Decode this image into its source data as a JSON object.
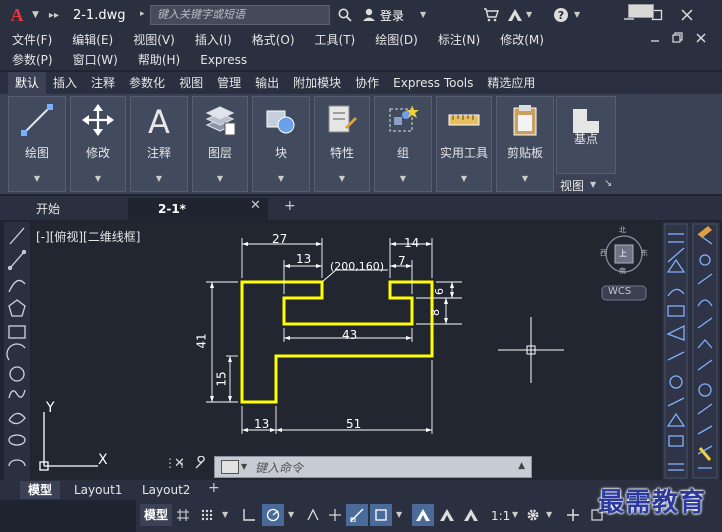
{
  "window": {
    "logo_letter": "A",
    "document_title": "2-1.dwg",
    "search_placeholder": "键入关键字或短语",
    "login_label": "登录"
  },
  "menu": {
    "row1": [
      "文件(F)",
      "编辑(E)",
      "视图(V)",
      "插入(I)",
      "格式(O)",
      "工具(T)",
      "绘图(D)",
      "标注(N)",
      "修改(M)"
    ],
    "row2": [
      "参数(P)",
      "窗口(W)",
      "帮助(H)",
      "Express"
    ]
  },
  "ribbon_tabs": [
    "默认",
    "插入",
    "注释",
    "参数化",
    "视图",
    "管理",
    "输出",
    "附加模块",
    "协作",
    "Express Tools",
    "精选应用"
  ],
  "ribbon_panels": [
    {
      "label": "绘图",
      "icon": "line-tool-icon"
    },
    {
      "label": "修改",
      "icon": "move-icon"
    },
    {
      "label": "注释",
      "icon": "text-a-icon"
    },
    {
      "label": "图层",
      "icon": "layers-icon"
    },
    {
      "label": "块",
      "icon": "block-icon"
    },
    {
      "label": "特性",
      "icon": "properties-icon"
    },
    {
      "label": "组",
      "icon": "group-icon"
    },
    {
      "label": "实用工具",
      "icon": "measure-icon"
    },
    {
      "label": "剪贴板",
      "icon": "clipboard-icon"
    },
    {
      "label": "基点",
      "icon": "base-point-icon"
    }
  ],
  "view_panel_label": "视图",
  "doc_tabs": [
    {
      "label": "开始"
    },
    {
      "label": "2-1*"
    }
  ],
  "drawing": {
    "view_caption": "[-][俯视][二维线框]",
    "dimensions": {
      "d27": "27",
      "d13_top": "13",
      "d200_160": "(200,160)",
      "d14": "14",
      "d7": "7",
      "d6": "6",
      "d8": "8",
      "d43": "43",
      "d41": "41",
      "d15": "15",
      "d13_bottom": "13",
      "d51": "51"
    },
    "compass": {
      "north": "北",
      "south": "南",
      "west": "西",
      "east": "东",
      "top_face": "上"
    },
    "wcs_label": "WCS",
    "axis_x": "X",
    "axis_y": "Y",
    "shape_color": "#ffff00",
    "dim_color": "#ffffff"
  },
  "command_line": {
    "placeholder": "键入命令"
  },
  "layout_tabs": [
    "模型",
    "Layout1",
    "Layout2"
  ],
  "status": {
    "model_label": "模型",
    "scale": "1:1"
  },
  "watermark": "最需教育"
}
